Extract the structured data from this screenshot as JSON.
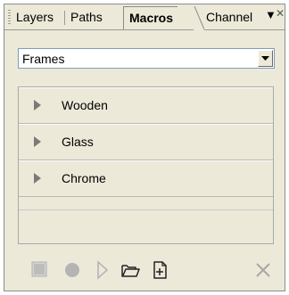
{
  "tabs": [
    {
      "label": "Layers",
      "active": false
    },
    {
      "label": "Paths",
      "active": false
    },
    {
      "label": "Macros",
      "active": true
    },
    {
      "label": "Channel",
      "active": false
    }
  ],
  "tab_menu_icon": "menu-arrow-icon",
  "close_icon": "close-icon",
  "dropdown": {
    "selected": "Frames"
  },
  "macros": [
    {
      "label": "Wooden"
    },
    {
      "label": "Glass"
    },
    {
      "label": "Chrome"
    }
  ],
  "toolbar": [
    {
      "icon": "stop-icon",
      "enabled": false
    },
    {
      "icon": "record-icon",
      "enabled": false
    },
    {
      "icon": "play-icon",
      "enabled": false
    },
    {
      "icon": "open-folder-icon",
      "enabled": true
    },
    {
      "icon": "new-macro-icon",
      "enabled": true
    },
    {
      "icon": "delete-icon",
      "enabled": false
    }
  ],
  "colors": {
    "panel_bg": "#ece9d8",
    "disabled_icon": "#a0a0a0",
    "border": "#8e8e8e"
  }
}
